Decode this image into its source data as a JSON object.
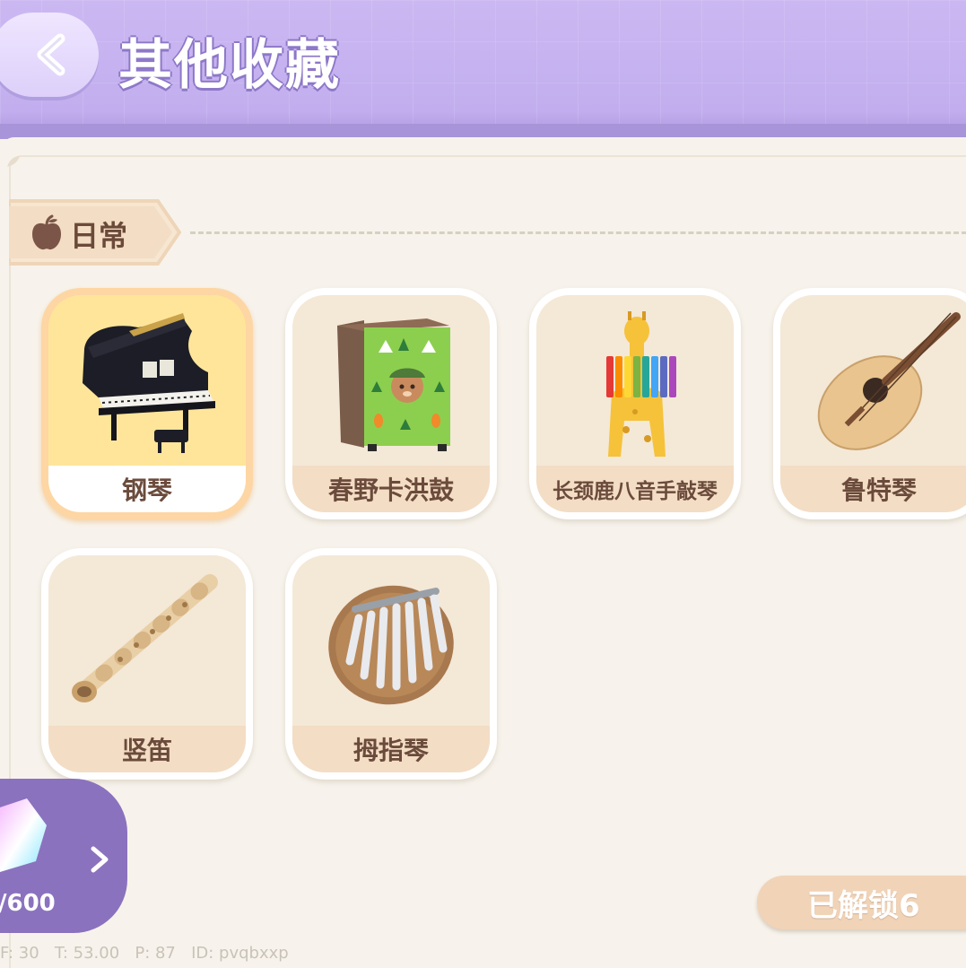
{
  "header": {
    "title": "其他收藏",
    "back_icon": "chevron-left-icon"
  },
  "section": {
    "label": "日常",
    "icon": "apple-icon"
  },
  "items": [
    {
      "name": "钢琴",
      "icon": "grand-piano-icon",
      "selected": true
    },
    {
      "name": "春野卡洪鼓",
      "icon": "cajon-drum-icon",
      "selected": false
    },
    {
      "name": "长颈鹿八音手敲琴",
      "icon": "giraffe-xylophone-icon",
      "selected": false
    },
    {
      "name": "鲁特琴",
      "icon": "lute-icon",
      "selected": false
    },
    {
      "name": "竖笛",
      "icon": "recorder-icon",
      "selected": false
    },
    {
      "name": "拇指琴",
      "icon": "kalimba-icon",
      "selected": false
    }
  ],
  "collection_badge": {
    "count_text": "/600",
    "icon": "crystal-icon"
  },
  "unlocked_label": "已解锁6",
  "debug": {
    "fps": "F: 30",
    "time": "T: 53.00",
    "ping": "P: 87",
    "id": "ID: pvqbxxp"
  },
  "colors": {
    "header": "#c2aeee",
    "accent_purple": "#8b72be",
    "card_beige": "#f3ddc5",
    "selected_orange": "#fdd6a4"
  }
}
